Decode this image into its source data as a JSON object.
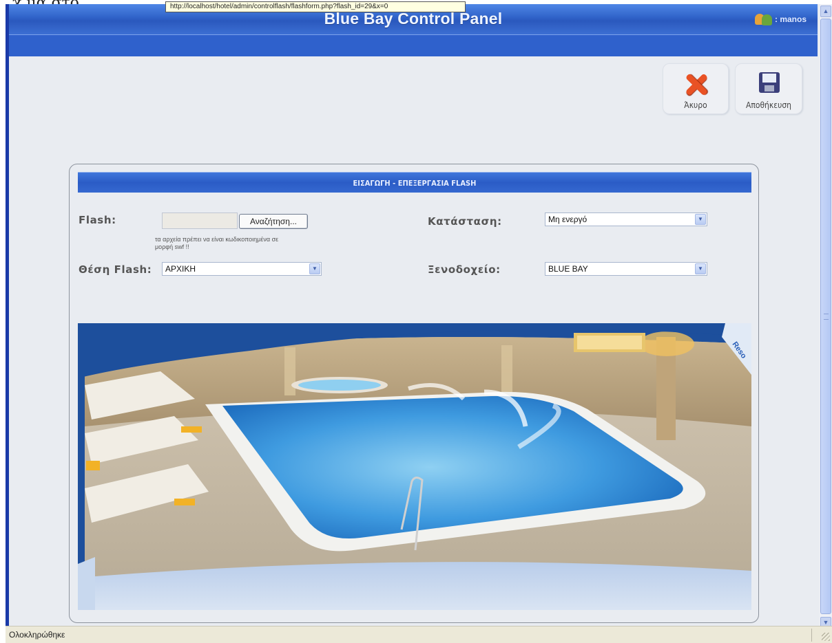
{
  "top_cut_text": "χ μα στο",
  "tooltip_url": "http://localhost/hotel/admin/controlflash/flashform.php?flash_id=29&x=0",
  "header": {
    "title": "Blue Bay Control Panel",
    "user_label": ": manos",
    "user_icon": "users-icon"
  },
  "toolbar": {
    "cancel_label": "Άκυρο",
    "cancel_icon": "x-icon",
    "save_label": "Αποθήκευση",
    "save_icon": "floppy-disk-icon"
  },
  "form": {
    "title": "ΕΙΣΑΓΩΓΗ - ΕΠΕΞΕΡΓΑΣΙΑ FLASH",
    "flash_label": "Flash:",
    "flash_value": "",
    "browse_label": "Αναζήτηση...",
    "file_note": "τα αρχεία πρέπει να είναι κωδικοποιημένα σε μορφή swf !!",
    "position_label": "Θέση Flash:",
    "position_value": "ΑΡΧΙΚΗ",
    "status_label": "Κατάσταση:",
    "status_value": "Μη ενεργό",
    "hotel_label": "Ξενοδοχείο:",
    "hotel_value": "BLUE BAY",
    "preview_badge": "Reso"
  },
  "statusbar": {
    "text": "Ολοκληρώθηκε"
  },
  "colors": {
    "header_blue": "#2f62c8",
    "cancel_red": "#e95224"
  }
}
